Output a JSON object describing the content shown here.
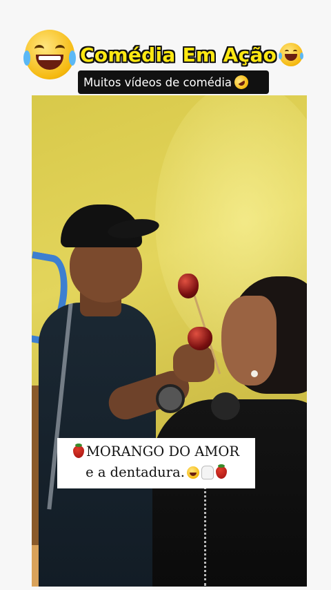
{
  "header": {
    "title": "Comédia Em Ação",
    "title_emoji_left": "face-with-tears-of-joy-icon",
    "title_emoji_right": "face-with-tears-of-joy-icon",
    "subtitle": "Muitos vídeos de comédia",
    "subtitle_emoji": "rolling-on-floor-laughing-icon"
  },
  "video": {
    "caption_line1": "MORANGO DO AMOR",
    "caption_line2": "e a dentadura.",
    "caption_icons": [
      "strawberry-icon",
      "face-with-tears-of-joy-icon",
      "tooth-icon",
      "strawberry-icon"
    ]
  },
  "colors": {
    "title_yellow": "#ffe812",
    "subtitle_bg": "#111111",
    "wall_yellow": "#d8c94a"
  }
}
